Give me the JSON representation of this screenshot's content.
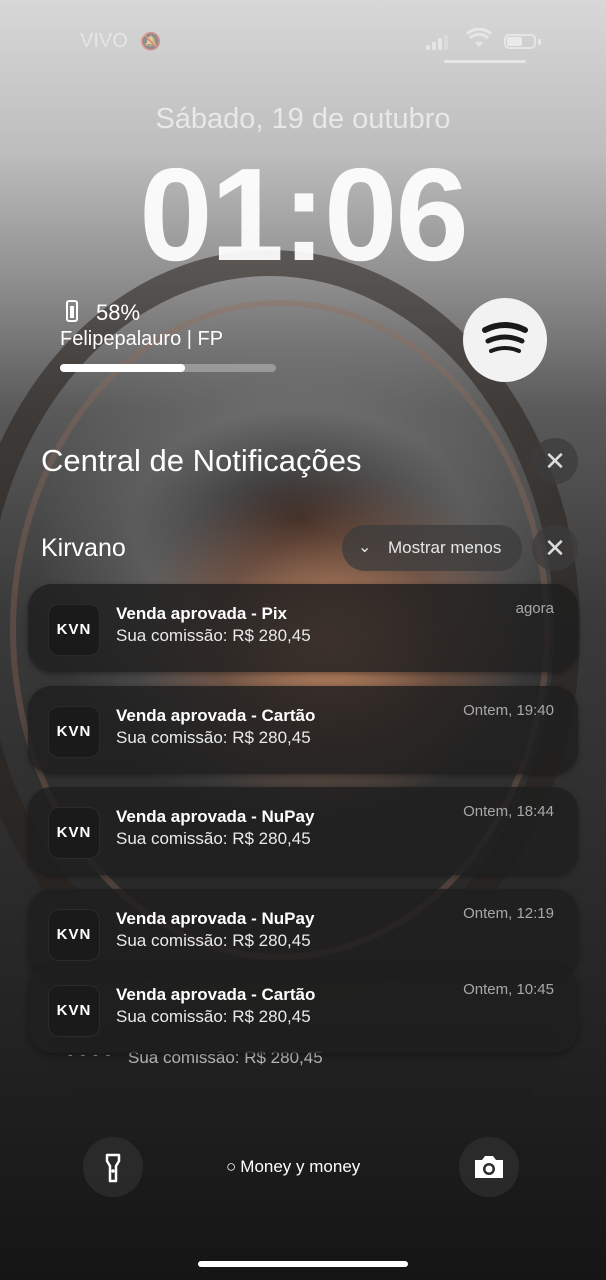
{
  "status_bar": {
    "carrier": "VIVO",
    "silent_icon": "bell-slash-icon",
    "signal_icon": "cellular-signal-icon",
    "wifi_icon": "wifi-icon",
    "battery_icon": "battery-icon"
  },
  "lock": {
    "date": "Sábado, 19 de outubro",
    "time": "01:06"
  },
  "battery_widget": {
    "device_icon": "phone-icon",
    "percent": "58%",
    "device_name": "Felipepalauro | FP",
    "level": 0.58
  },
  "music_widget": {
    "app_icon": "spotify-icon"
  },
  "notification_center": {
    "title": "Central de Notificações",
    "close_icon": "close-icon"
  },
  "group": {
    "name": "Kirvano",
    "show_less_label": "Mostrar menos",
    "chevron_icon": "chevron-down-icon",
    "close_icon": "close-icon"
  },
  "notifications": [
    {
      "app": "KVN",
      "title": "Venda aprovada - Pix",
      "body": "Sua comissão: R$ 280,45",
      "time": "agora"
    },
    {
      "app": "KVN",
      "title": "Venda aprovada - Cartão",
      "body": "Sua comissão: R$ 280,45",
      "time": "Ontem, 19:40"
    },
    {
      "app": "KVN",
      "title": "Venda aprovada - NuPay",
      "body": "Sua comissão: R$ 280,45",
      "time": "Ontem, 18:44"
    },
    {
      "app": "KVN",
      "title": "Venda aprovada - NuPay",
      "body": "Sua comissão: R$ 280,45",
      "time": "Ontem, 12:19"
    },
    {
      "app": "KVN",
      "title": "Venda aprovada - Cartão",
      "body": "Sua comissão: R$ 280,45",
      "time": "Ontem, 10:45"
    }
  ],
  "stacked_peek": {
    "body": "Sua comissão: R$ 280,45"
  },
  "bottom": {
    "flashlight_icon": "flashlight-icon",
    "focus_icon": "flame-icon",
    "now_playing": "Money y money",
    "camera_icon": "camera-icon"
  }
}
